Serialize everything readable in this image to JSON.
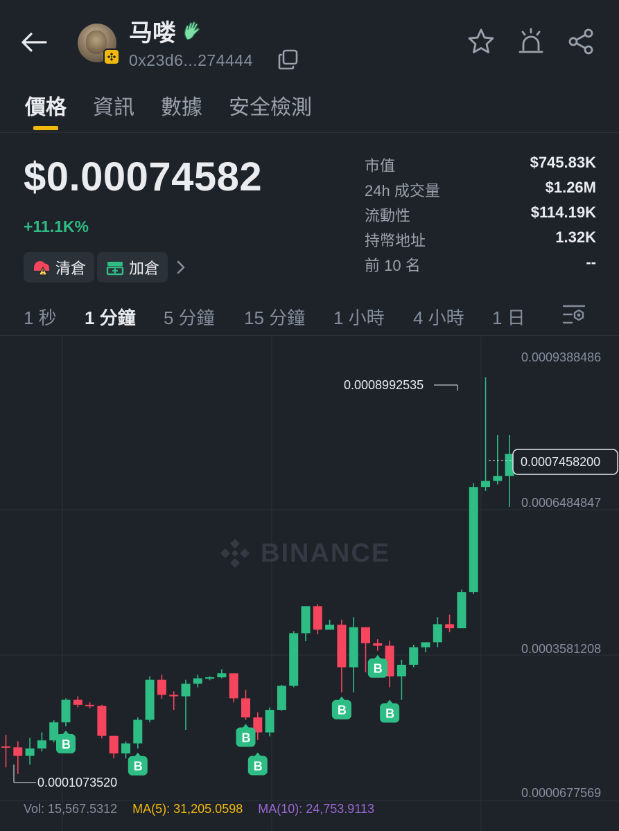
{
  "header": {
    "token_name": "马喽",
    "token_address": "0x23d6...274444"
  },
  "tabs": [
    {
      "label": "價格",
      "active": true
    },
    {
      "label": "資訊",
      "active": false
    },
    {
      "label": "數據",
      "active": false
    },
    {
      "label": "安全檢測",
      "active": false
    }
  ],
  "price": {
    "current": "$0.00074582",
    "change": "+11.1K%"
  },
  "actions": {
    "clear_label": "清倉",
    "add_label": "加倉"
  },
  "stats": [
    {
      "label": "市值",
      "value": "$745.83K"
    },
    {
      "label": "24h 成交量",
      "value": "$1.26M"
    },
    {
      "label": "流動性",
      "value": "$114.19K"
    },
    {
      "label": "持幣地址",
      "value": "1.32K"
    },
    {
      "label": "前 10 名",
      "value": "--"
    }
  ],
  "intervals": [
    {
      "label": "1 秒",
      "active": false
    },
    {
      "label": "1 分鐘",
      "active": true
    },
    {
      "label": "5 分鐘",
      "active": false
    },
    {
      "label": "15 分鐘",
      "active": false
    },
    {
      "label": "1 小時",
      "active": false
    },
    {
      "label": "4 小時",
      "active": false
    },
    {
      "label": "1 日",
      "active": false
    }
  ],
  "chart": {
    "watermark": "BINANCE",
    "y_ticks": [
      "0.0009388486",
      "0.0006484847",
      "0.0003581208",
      "0.0000677569"
    ],
    "high_label": "0.0008992535",
    "low_label": "0.0001073520",
    "current_label": "0.0007458200",
    "buy_marker": "B",
    "vol_label": "Vol: 15,567.5312",
    "ma5_label": "MA(5): 31,205.0598",
    "ma10_label": "MA(10): 24,753.9113"
  },
  "colors": {
    "up": "#2ebd85",
    "down": "#f6465d",
    "accent": "#f0b90b"
  },
  "chart_data": {
    "type": "candlestick",
    "y_ticks": [
      0.0009388486,
      0.0006484847,
      0.0003581208,
      6.77569e-05
    ],
    "ylim": [
      6.77569e-05,
      0.0009388486
    ],
    "candles": [
      {
        "o": 0.000162,
        "h": 0.000185,
        "l": 0.00012,
        "c": 0.00016
      },
      {
        "o": 0.00016,
        "h": 0.000172,
        "l": 0.000107,
        "c": 0.000143
      },
      {
        "o": 0.000143,
        "h": 0.000179,
        "l": 0.000126,
        "c": 0.000158
      },
      {
        "o": 0.000158,
        "h": 0.00019,
        "l": 0.000152,
        "c": 0.000174
      },
      {
        "o": 0.000174,
        "h": 0.000214,
        "l": 0.00017,
        "c": 0.00021
      },
      {
        "o": 0.00021,
        "h": 0.000258,
        "l": 0.000202,
        "c": 0.000255
      },
      {
        "o": 0.000255,
        "h": 0.000262,
        "l": 0.00024,
        "c": 0.000245
      },
      {
        "o": 0.000245,
        "h": 0.00025,
        "l": 0.000238,
        "c": 0.000243
      },
      {
        "o": 0.000243,
        "h": 0.000245,
        "l": 0.000178,
        "c": 0.000183
      },
      {
        "o": 0.000183,
        "h": 0.000183,
        "l": 0.000138,
        "c": 0.000148
      },
      {
        "o": 0.000148,
        "h": 0.000172,
        "l": 0.000138,
        "c": 0.000168
      },
      {
        "o": 0.000168,
        "h": 0.00022,
        "l": 0.000158,
        "c": 0.000215
      },
      {
        "o": 0.000215,
        "h": 0.000302,
        "l": 0.00021,
        "c": 0.000295
      },
      {
        "o": 0.000295,
        "h": 0.000305,
        "l": 0.000257,
        "c": 0.000265
      },
      {
        "o": 0.000265,
        "h": 0.000272,
        "l": 0.000235,
        "c": 0.000262
      },
      {
        "o": 0.000262,
        "h": 0.000295,
        "l": 0.000195,
        "c": 0.000287
      },
      {
        "o": 0.000287,
        "h": 0.000305,
        "l": 0.00028,
        "c": 0.000298
      },
      {
        "o": 0.000298,
        "h": 0.000302,
        "l": 0.000294,
        "c": 0.0003
      },
      {
        "o": 0.0003,
        "h": 0.000316,
        "l": 0.000298,
        "c": 0.000308
      },
      {
        "o": 0.000308,
        "h": 0.000308,
        "l": 0.00025,
        "c": 0.000258
      },
      {
        "o": 0.000258,
        "h": 0.000275,
        "l": 0.000215,
        "c": 0.00022
      },
      {
        "o": 0.00022,
        "h": 0.00023,
        "l": 0.000175,
        "c": 0.00019
      },
      {
        "o": 0.00019,
        "h": 0.00024,
        "l": 0.000182,
        "c": 0.000235
      },
      {
        "o": 0.000235,
        "h": 0.000285,
        "l": 0.000233,
        "c": 0.000283
      },
      {
        "o": 0.000283,
        "h": 0.000392,
        "l": 0.00028,
        "c": 0.000388
      },
      {
        "o": 0.000388,
        "h": 0.00044,
        "l": 0.000372,
        "c": 0.000442
      },
      {
        "o": 0.000442,
        "h": 0.000446,
        "l": 0.000386,
        "c": 0.000395
      },
      {
        "o": 0.000395,
        "h": 0.000415,
        "l": 0.000398,
        "c": 0.000405
      },
      {
        "o": 0.000405,
        "h": 0.000415,
        "l": 0.00027,
        "c": 0.00032
      },
      {
        "o": 0.00032,
        "h": 0.00042,
        "l": 0.00027,
        "c": 0.0004
      },
      {
        "o": 0.0004,
        "h": 0.0004,
        "l": 0.00031,
        "c": 0.000368
      },
      {
        "o": 0.000368,
        "h": 0.000376,
        "l": 0.000353,
        "c": 0.000363
      },
      {
        "o": 0.000363,
        "h": 0.000373,
        "l": 0.00028,
        "c": 0.000302
      },
      {
        "o": 0.000302,
        "h": 0.000335,
        "l": 0.000255,
        "c": 0.000325
      },
      {
        "o": 0.000325,
        "h": 0.000365,
        "l": 0.00032,
        "c": 0.00036
      },
      {
        "o": 0.00036,
        "h": 0.00037,
        "l": 0.00035,
        "c": 0.00037
      },
      {
        "o": 0.00037,
        "h": 0.00042,
        "l": 0.00036,
        "c": 0.000406
      },
      {
        "o": 0.000406,
        "h": 0.000425,
        "l": 0.00039,
        "c": 0.000398
      },
      {
        "o": 0.000398,
        "h": 0.000475,
        "l": 0.000398,
        "c": 0.00047
      },
      {
        "o": 0.00047,
        "h": 0.000688,
        "l": 0.000466,
        "c": 0.00068
      },
      {
        "o": 0.00068,
        "h": 0.000899,
        "l": 0.000672,
        "c": 0.000692
      },
      {
        "o": 0.000692,
        "h": 0.000784,
        "l": 0.000685,
        "c": 0.000702
      },
      {
        "o": 0.000702,
        "h": 0.000784,
        "l": 0.00064,
        "c": 0.000746
      }
    ],
    "buy_markers": [
      5,
      11,
      20,
      21,
      28,
      31,
      32
    ]
  }
}
